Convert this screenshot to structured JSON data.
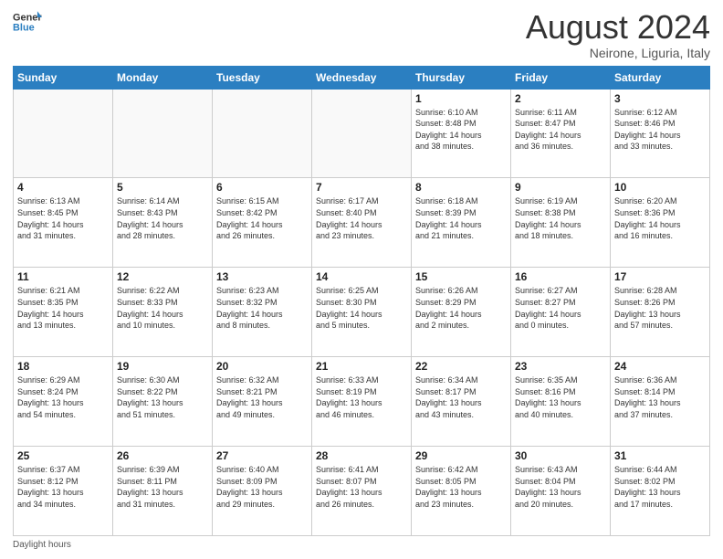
{
  "logo": {
    "line1": "General",
    "line2": "Blue"
  },
  "header": {
    "month": "August 2024",
    "location": "Neirone, Liguria, Italy"
  },
  "days_header": [
    "Sunday",
    "Monday",
    "Tuesday",
    "Wednesday",
    "Thursday",
    "Friday",
    "Saturday"
  ],
  "weeks": [
    [
      {
        "num": "",
        "info": ""
      },
      {
        "num": "",
        "info": ""
      },
      {
        "num": "",
        "info": ""
      },
      {
        "num": "",
        "info": ""
      },
      {
        "num": "1",
        "info": "Sunrise: 6:10 AM\nSunset: 8:48 PM\nDaylight: 14 hours\nand 38 minutes."
      },
      {
        "num": "2",
        "info": "Sunrise: 6:11 AM\nSunset: 8:47 PM\nDaylight: 14 hours\nand 36 minutes."
      },
      {
        "num": "3",
        "info": "Sunrise: 6:12 AM\nSunset: 8:46 PM\nDaylight: 14 hours\nand 33 minutes."
      }
    ],
    [
      {
        "num": "4",
        "info": "Sunrise: 6:13 AM\nSunset: 8:45 PM\nDaylight: 14 hours\nand 31 minutes."
      },
      {
        "num": "5",
        "info": "Sunrise: 6:14 AM\nSunset: 8:43 PM\nDaylight: 14 hours\nand 28 minutes."
      },
      {
        "num": "6",
        "info": "Sunrise: 6:15 AM\nSunset: 8:42 PM\nDaylight: 14 hours\nand 26 minutes."
      },
      {
        "num": "7",
        "info": "Sunrise: 6:17 AM\nSunset: 8:40 PM\nDaylight: 14 hours\nand 23 minutes."
      },
      {
        "num": "8",
        "info": "Sunrise: 6:18 AM\nSunset: 8:39 PM\nDaylight: 14 hours\nand 21 minutes."
      },
      {
        "num": "9",
        "info": "Sunrise: 6:19 AM\nSunset: 8:38 PM\nDaylight: 14 hours\nand 18 minutes."
      },
      {
        "num": "10",
        "info": "Sunrise: 6:20 AM\nSunset: 8:36 PM\nDaylight: 14 hours\nand 16 minutes."
      }
    ],
    [
      {
        "num": "11",
        "info": "Sunrise: 6:21 AM\nSunset: 8:35 PM\nDaylight: 14 hours\nand 13 minutes."
      },
      {
        "num": "12",
        "info": "Sunrise: 6:22 AM\nSunset: 8:33 PM\nDaylight: 14 hours\nand 10 minutes."
      },
      {
        "num": "13",
        "info": "Sunrise: 6:23 AM\nSunset: 8:32 PM\nDaylight: 14 hours\nand 8 minutes."
      },
      {
        "num": "14",
        "info": "Sunrise: 6:25 AM\nSunset: 8:30 PM\nDaylight: 14 hours\nand 5 minutes."
      },
      {
        "num": "15",
        "info": "Sunrise: 6:26 AM\nSunset: 8:29 PM\nDaylight: 14 hours\nand 2 minutes."
      },
      {
        "num": "16",
        "info": "Sunrise: 6:27 AM\nSunset: 8:27 PM\nDaylight: 14 hours\nand 0 minutes."
      },
      {
        "num": "17",
        "info": "Sunrise: 6:28 AM\nSunset: 8:26 PM\nDaylight: 13 hours\nand 57 minutes."
      }
    ],
    [
      {
        "num": "18",
        "info": "Sunrise: 6:29 AM\nSunset: 8:24 PM\nDaylight: 13 hours\nand 54 minutes."
      },
      {
        "num": "19",
        "info": "Sunrise: 6:30 AM\nSunset: 8:22 PM\nDaylight: 13 hours\nand 51 minutes."
      },
      {
        "num": "20",
        "info": "Sunrise: 6:32 AM\nSunset: 8:21 PM\nDaylight: 13 hours\nand 49 minutes."
      },
      {
        "num": "21",
        "info": "Sunrise: 6:33 AM\nSunset: 8:19 PM\nDaylight: 13 hours\nand 46 minutes."
      },
      {
        "num": "22",
        "info": "Sunrise: 6:34 AM\nSunset: 8:17 PM\nDaylight: 13 hours\nand 43 minutes."
      },
      {
        "num": "23",
        "info": "Sunrise: 6:35 AM\nSunset: 8:16 PM\nDaylight: 13 hours\nand 40 minutes."
      },
      {
        "num": "24",
        "info": "Sunrise: 6:36 AM\nSunset: 8:14 PM\nDaylight: 13 hours\nand 37 minutes."
      }
    ],
    [
      {
        "num": "25",
        "info": "Sunrise: 6:37 AM\nSunset: 8:12 PM\nDaylight: 13 hours\nand 34 minutes."
      },
      {
        "num": "26",
        "info": "Sunrise: 6:39 AM\nSunset: 8:11 PM\nDaylight: 13 hours\nand 31 minutes."
      },
      {
        "num": "27",
        "info": "Sunrise: 6:40 AM\nSunset: 8:09 PM\nDaylight: 13 hours\nand 29 minutes."
      },
      {
        "num": "28",
        "info": "Sunrise: 6:41 AM\nSunset: 8:07 PM\nDaylight: 13 hours\nand 26 minutes."
      },
      {
        "num": "29",
        "info": "Sunrise: 6:42 AM\nSunset: 8:05 PM\nDaylight: 13 hours\nand 23 minutes."
      },
      {
        "num": "30",
        "info": "Sunrise: 6:43 AM\nSunset: 8:04 PM\nDaylight: 13 hours\nand 20 minutes."
      },
      {
        "num": "31",
        "info": "Sunrise: 6:44 AM\nSunset: 8:02 PM\nDaylight: 13 hours\nand 17 minutes."
      }
    ]
  ],
  "footer": {
    "daylight_label": "Daylight hours"
  }
}
